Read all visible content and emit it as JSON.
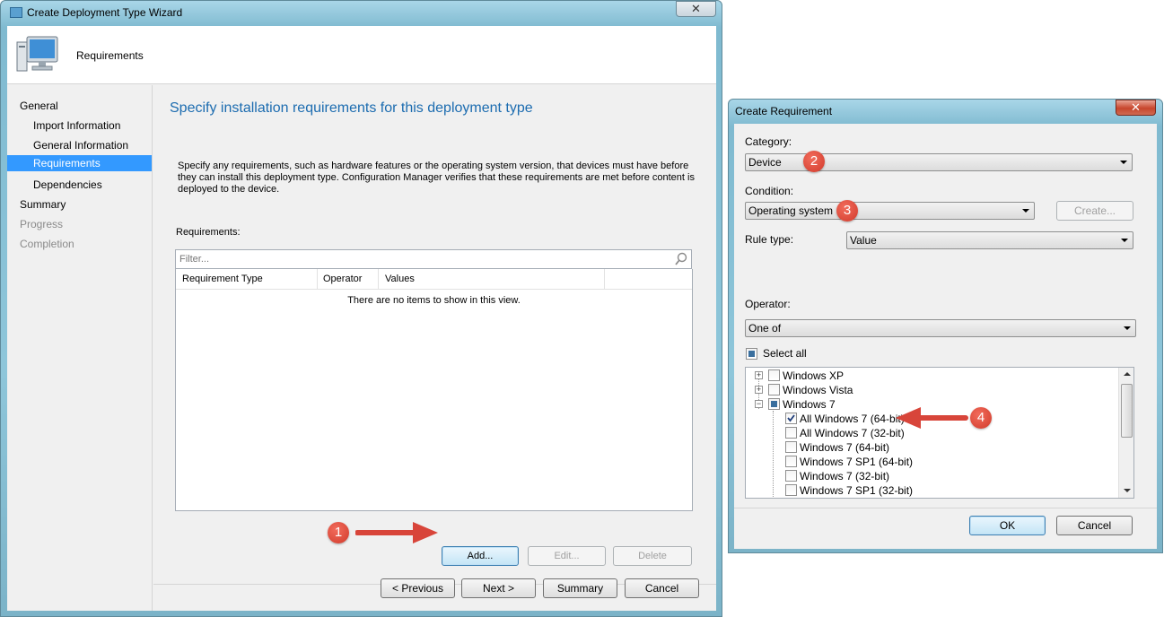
{
  "wizard": {
    "title": "Create Deployment Type Wizard",
    "close": "✕",
    "header_page": "Requirements",
    "nav": [
      {
        "label": "General",
        "level": 0,
        "state": "normal"
      },
      {
        "label": "Import Information",
        "level": 1,
        "state": "normal"
      },
      {
        "label": "General Information",
        "level": 1,
        "state": "normal"
      },
      {
        "label": "Requirements",
        "level": 1,
        "state": "selected"
      },
      {
        "label": "Dependencies",
        "level": 1,
        "state": "normal"
      },
      {
        "label": "Summary",
        "level": 0,
        "state": "normal"
      },
      {
        "label": "Progress",
        "level": 0,
        "state": "disabled"
      },
      {
        "label": "Completion",
        "level": 0,
        "state": "disabled"
      }
    ],
    "heading": "Specify installation requirements for this deployment type",
    "description": "Specify any requirements, such as hardware features or the operating system version, that devices must have before they can install this deployment type. Configuration Manager verifies that these requirements are met before content is deployed to the device.",
    "requirements_label": "Requirements:",
    "filter_placeholder": "Filter...",
    "columns": [
      "Requirement Type",
      "Operator",
      "Values"
    ],
    "empty_text": "There are no items to show in this view.",
    "buttons": {
      "add": "Add...",
      "edit": "Edit...",
      "delete": "Delete"
    },
    "footer": {
      "previous": "< Previous",
      "next": "Next >",
      "summary": "Summary",
      "cancel": "Cancel"
    }
  },
  "dialog": {
    "title": "Create Requirement",
    "close": "✕",
    "category_label": "Category:",
    "category_value": "Device",
    "condition_label": "Condition:",
    "condition_value": "Operating system",
    "create_button": "Create...",
    "rule_type_label": "Rule type:",
    "rule_type_value": "Value",
    "operator_label": "Operator:",
    "operator_value": "One of",
    "select_all": "Select all",
    "tree": [
      {
        "label": "Windows XP",
        "level": 0,
        "expander": "+",
        "checked": "unchecked"
      },
      {
        "label": "Windows Vista",
        "level": 0,
        "expander": "+",
        "checked": "unchecked"
      },
      {
        "label": "Windows 7",
        "level": 0,
        "expander": "−",
        "checked": "partial"
      },
      {
        "label": "All Windows 7 (64-bit)",
        "level": 1,
        "checked": "checked"
      },
      {
        "label": "All Windows 7 (32-bit)",
        "level": 1,
        "checked": "unchecked"
      },
      {
        "label": "Windows 7 (64-bit)",
        "level": 1,
        "checked": "unchecked"
      },
      {
        "label": "Windows 7 SP1 (64-bit)",
        "level": 1,
        "checked": "unchecked"
      },
      {
        "label": "Windows 7 (32-bit)",
        "level": 1,
        "checked": "unchecked"
      },
      {
        "label": "Windows 7 SP1 (32-bit)",
        "level": 1,
        "checked": "unchecked"
      }
    ],
    "ok": "OK",
    "cancel": "Cancel"
  },
  "annotations": [
    "1",
    "2",
    "3",
    "4"
  ],
  "colors": {
    "accent_blue": "#1c6cb0",
    "selected_nav": "#3399ff",
    "badge_red": "#d13a2b",
    "arrow_red": "#d8453a"
  }
}
